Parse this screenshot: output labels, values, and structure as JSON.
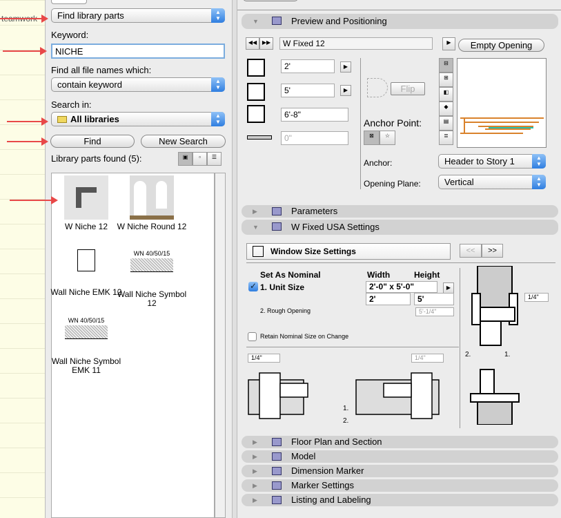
{
  "canvas": {
    "text": "teamwork"
  },
  "search": {
    "mode": "Find library parts",
    "keyword_label": "Keyword:",
    "keyword_value": "NICHE",
    "filename_label": "Find all file names which:",
    "filename_option": "contain keyword",
    "search_in_label": "Search in:",
    "search_in_value": "All libraries",
    "find_label": "Find",
    "new_search_label": "New Search",
    "found_label": "Library parts found (5):"
  },
  "results": [
    {
      "name": "W Niche 12",
      "icon": "niche-thumbnail"
    },
    {
      "name": "W Niche Round 12",
      "icon": "niche-round-thumbnail"
    },
    {
      "name": "Wall Niche EMK 12",
      "icon": "document-icon"
    },
    {
      "name": "Wall Niche Symbol 12",
      "icon": "niche-symbol",
      "caption": "WN 40/50/15"
    },
    {
      "name": "Wall Niche Symbol EMK 11",
      "icon": "niche-symbol",
      "caption": "WN 40/50/15"
    }
  ],
  "preview": {
    "section_title": "Preview and Positioning",
    "part_name": "W Fixed 12",
    "empty_opening_label": "Empty Opening",
    "width": "2'",
    "height": "5'",
    "sill": "6'-8\"",
    "offset": "0\"",
    "flip_label": "Flip",
    "anchor_point_label": "Anchor Point:",
    "anchor_label": "Anchor:",
    "anchor_value": "Header to Story 1",
    "opening_plane_label": "Opening Plane:",
    "opening_plane_value": "Vertical",
    "preview_colors": {
      "frame": "#d9822b",
      "glass": "#22c0b0"
    }
  },
  "parameters_title": "Parameters",
  "settings": {
    "section_title": "W Fixed USA Settings",
    "page_label": "Window Size Settings",
    "prev_label": "<<",
    "next_label": ">>",
    "set_nominal_label": "Set As Nominal",
    "width_header": "Width",
    "height_header": "Height",
    "unit_size_label": "1. Unit Size",
    "unit_size_checked": true,
    "unit_size_value": "2'-0\" x 5'-0\"",
    "unit_width": "2'",
    "unit_height": "5'",
    "rough_opening_label": "2. Rough Opening",
    "rough_height": "5'-1/4\"",
    "retain_label": "Retain Nominal Size on Change",
    "retain_checked": false,
    "gap_left": "1/4\"",
    "gap_right": "1/4\"",
    "gap_side": "1/4\"",
    "dim1": "1.",
    "dim2": "2."
  },
  "sections": [
    "Floor Plan and Section",
    "Model",
    "Dimension Marker",
    "Marker Settings",
    "Listing and Labeling"
  ]
}
